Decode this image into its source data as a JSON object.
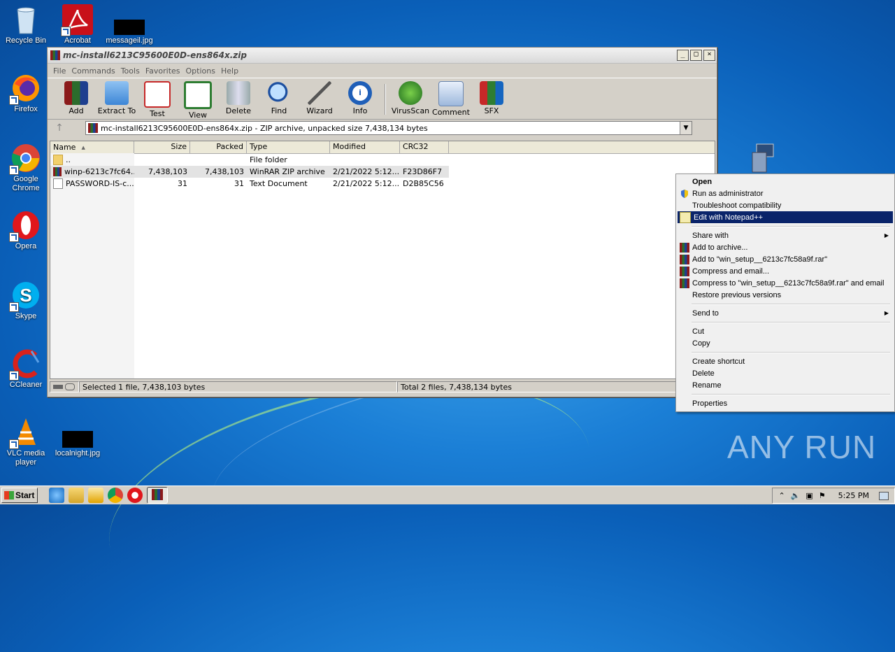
{
  "desktop": {
    "icons": [
      {
        "label": "Recycle Bin"
      },
      {
        "label": "Acrobat"
      },
      {
        "label": "messageil.jpg"
      },
      {
        "label": "Firefox"
      },
      {
        "label": "Google Chrome"
      },
      {
        "label": "Opera"
      },
      {
        "label": "Skype"
      },
      {
        "label": "CCleaner"
      },
      {
        "label": "VLC media player"
      },
      {
        "label": "localnight.jpg"
      }
    ]
  },
  "winrar": {
    "title": "mc-install6213C95600E0D-ens864x.zip",
    "menu": [
      "File",
      "Commands",
      "Tools",
      "Favorites",
      "Options",
      "Help"
    ],
    "toolbar": [
      "Add",
      "Extract To",
      "Test",
      "View",
      "Delete",
      "Find",
      "Wizard",
      "Info",
      "VirusScan",
      "Comment",
      "SFX"
    ],
    "path": "mc-install6213C95600E0D-ens864x.zip - ZIP archive, unpacked size 7,438,134 bytes",
    "columns": [
      "Name",
      "Size",
      "Packed",
      "Type",
      "Modified",
      "CRC32"
    ],
    "rows": [
      {
        "name": "..",
        "size": "",
        "packed": "",
        "type": "File folder",
        "modified": "",
        "crc": ""
      },
      {
        "name": "winp-6213c7fc64...",
        "size": "7,438,103",
        "packed": "7,438,103",
        "type": "WinRAR ZIP archive",
        "modified": "2/21/2022 5:12...",
        "crc": "F23D86F7"
      },
      {
        "name": "PASSWORD-IS-c...",
        "size": "31",
        "packed": "31",
        "type": "Text Document",
        "modified": "2/21/2022 5:12...",
        "crc": "D2B85C56"
      }
    ],
    "status_left": "Selected 1 file, 7,438,103 bytes",
    "status_right": "Total 2 files, 7,438,134 bytes"
  },
  "context_menu": {
    "items": [
      {
        "label": "Open"
      },
      {
        "label": "Run as administrator"
      },
      {
        "label": "Troubleshoot compatibility"
      },
      {
        "label": "Edit with Notepad++"
      },
      {
        "label": "Share with"
      },
      {
        "label": "Add to archive..."
      },
      {
        "label": "Add to \"win_setup__6213c7fc58a9f.rar\""
      },
      {
        "label": "Compress and email..."
      },
      {
        "label": "Compress to \"win_setup__6213c7fc58a9f.rar\" and email"
      },
      {
        "label": "Restore previous versions"
      },
      {
        "label": "Send to"
      },
      {
        "label": "Cut"
      },
      {
        "label": "Copy"
      },
      {
        "label": "Create shortcut"
      },
      {
        "label": "Delete"
      },
      {
        "label": "Rename"
      },
      {
        "label": "Properties"
      }
    ]
  },
  "taskbar": {
    "start_label": "Start",
    "clock": "5:25 PM"
  },
  "watermark": "ANY RUN",
  "colors": {
    "menu_highlight": "#0a246a",
    "desktop_blue": "#1b7fd6"
  }
}
